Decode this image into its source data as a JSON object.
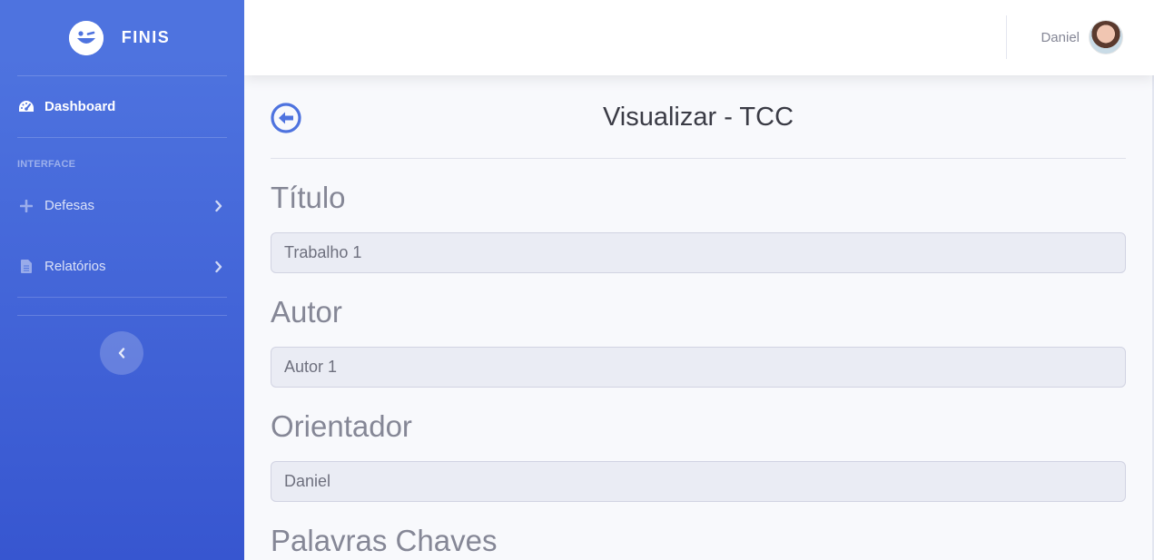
{
  "brand": {
    "name": "FINIS",
    "logo_icon": "winking-face-icon"
  },
  "sidebar": {
    "items": [
      {
        "label": "Dashboard",
        "icon": "tachometer-icon",
        "active": true
      },
      {
        "label": "Defesas",
        "icon": "plus-icon",
        "has_submenu": true
      },
      {
        "label": "Relatórios",
        "icon": "file-icon",
        "has_submenu": true
      }
    ],
    "heading": "INTERFACE",
    "toggle_icon": "chevron-left-icon"
  },
  "topbar": {
    "user_name": "Daniel",
    "avatar_icon": "user-avatar"
  },
  "page": {
    "title": "Visualizar - TCC",
    "back_icon": "arrow-circle-left-icon"
  },
  "form": {
    "fields": [
      {
        "label": "Título",
        "value": "Trabalho 1"
      },
      {
        "label": "Autor",
        "value": "Autor 1"
      },
      {
        "label": "Orientador",
        "value": "Daniel"
      }
    ],
    "next_label": "Palavras Chaves"
  },
  "colors": {
    "sidebar_top": "#4e73df",
    "sidebar_bottom": "#3756d0",
    "primary": "#4e73df",
    "background": "#f8f9fc",
    "field_bg": "#eaecf4"
  }
}
